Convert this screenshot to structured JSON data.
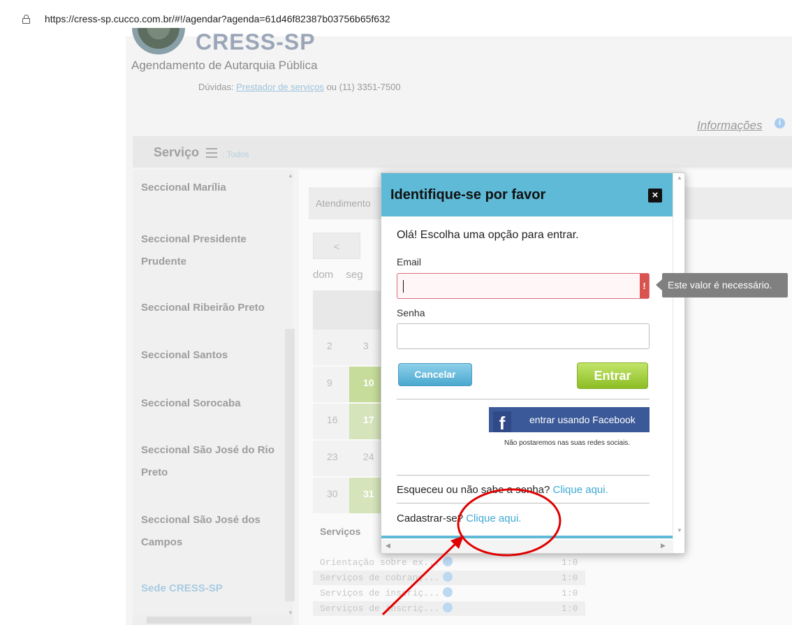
{
  "browser": {
    "url": "https://cress-sp.cucco.com.br/#!/agendar?agenda=61d46f82387b03756b65f632"
  },
  "header": {
    "logo_text": "CRESS-SP",
    "subtitle": "Agendamento de Autarquia Pública",
    "duvidas_label": "Dúvidas:",
    "duvidas_link": "Prestador de serviços",
    "duvidas_rest": "ou (11) 3351-7500",
    "info_link": "Informações"
  },
  "servico_bar": {
    "label": "Serviço",
    "filter": ": Todos"
  },
  "sidebar": {
    "items": [
      "Seccional Marília",
      "Seccional Presidente Prudente",
      "Seccional Ribeirão Preto",
      "Seccional Santos",
      "Seccional Sorocaba",
      "Seccional São José do Rio Preto",
      "Seccional São José dos Campos",
      "Sede CRESS-SP"
    ]
  },
  "main": {
    "atendimento": "Atendimento",
    "prev_button": "<",
    "day_headers": [
      "dom",
      "seg"
    ],
    "calendar": [
      [
        "2",
        "3"
      ],
      [
        "9",
        "10"
      ],
      [
        "16",
        "17"
      ],
      [
        "23",
        "24"
      ],
      [
        "30",
        "31"
      ]
    ],
    "servicos_title": "Serviços",
    "servicos": [
      {
        "name": "Orientação sobre ex...",
        "time": "1:0"
      },
      {
        "name": "Serviços de cobranç...",
        "time": "1:0"
      },
      {
        "name": "Serviços de inscriç...",
        "time": "1:0"
      },
      {
        "name": "Serviços de inscriç...",
        "time": "1:0"
      }
    ]
  },
  "modal": {
    "title": "Identifique-se por favor",
    "close": "×",
    "greeting": "Olá! Escolha uma opção para entrar.",
    "email_label": "Email",
    "password_label": "Senha",
    "error_flag": "!",
    "cancel_label": "Cancelar",
    "enter_label": "Entrar",
    "facebook_label": "entrar usando Facebook",
    "facebook_note": "Não postaremos nas suas redes sociais.",
    "forgot_text": "Esqueceu ou não sabe a senha?",
    "forgot_link": "Clique aqui.",
    "register_text": "Cadastrar-se?",
    "register_link": "Clique aqui."
  },
  "tooltip": {
    "text": "Este valor é necessário."
  },
  "colors": {
    "modal_header": "#5ebad6",
    "annotation": "#e00000",
    "facebook": "#3b5998",
    "enter_button": "#8dbd24",
    "cancel_button": "#4aa8cf"
  },
  "icons": [
    "lock-icon",
    "info-icon",
    "menu-icon",
    "close-icon",
    "facebook-icon",
    "error-icon"
  ]
}
